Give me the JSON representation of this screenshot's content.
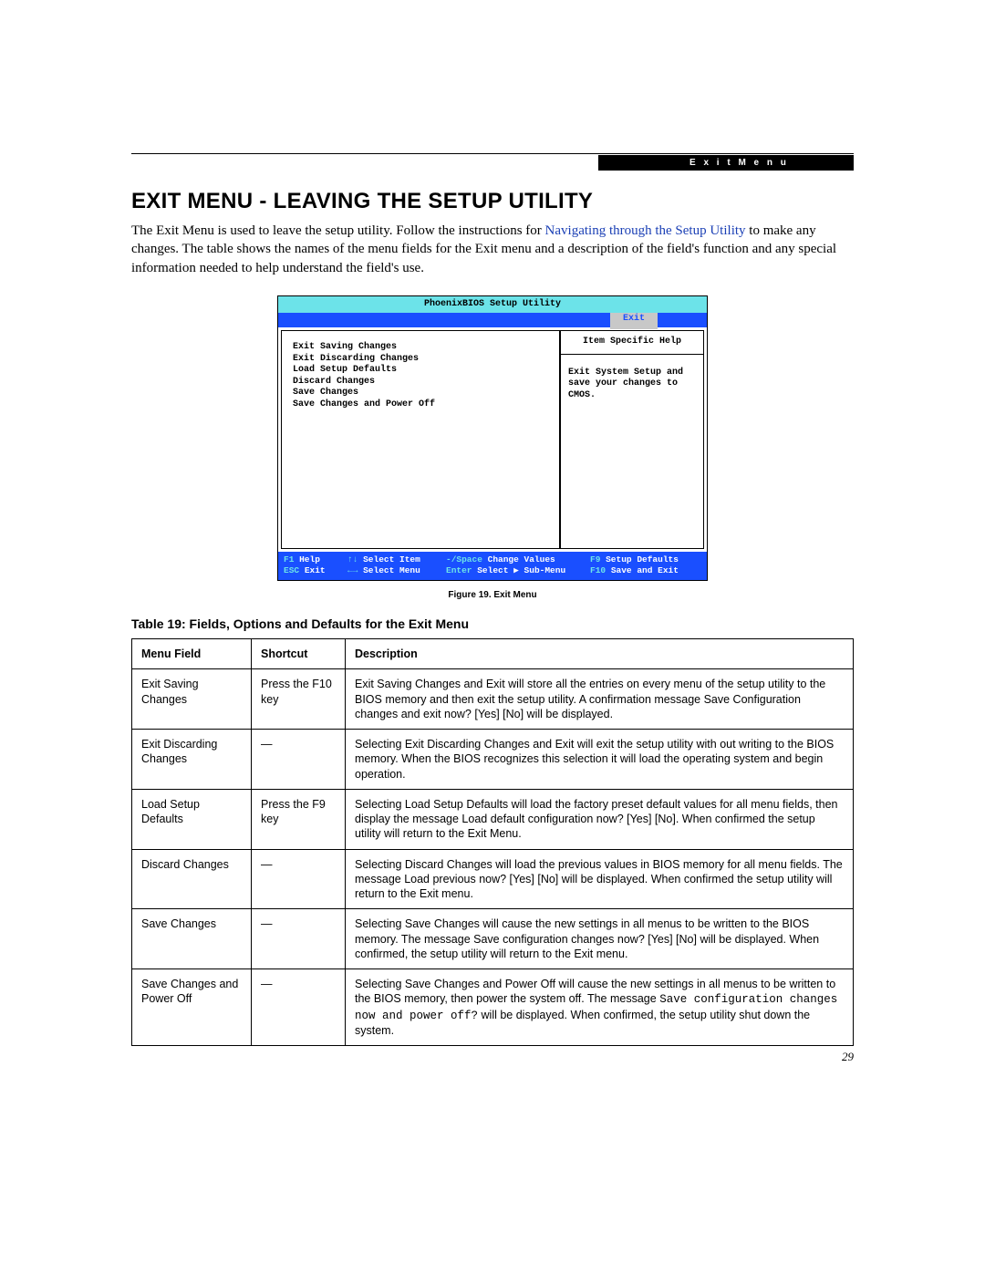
{
  "header": {
    "running_head": "E x i t   M e n u",
    "title": "EXIT MENU - LEAVING THE SETUP UTILITY",
    "intro_pre": "The Exit Menu is used to leave the setup utility. Follow the instructions for ",
    "intro_link": "Navigating through the Setup Utility",
    "intro_post": " to make any changes. The table shows the names of the menu fields for the Exit menu and a description of the field's function and any special information needed to help understand the field's use."
  },
  "bios": {
    "title": "PhoenixBIOS Setup Utility",
    "active_tab": "Exit",
    "menu_items": [
      "Exit Saving Changes",
      "Exit Discarding Changes",
      "Load Setup Defaults",
      "Discard Changes",
      "Save Changes",
      "Save Changes and Power Off"
    ],
    "help_title": "Item Specific Help",
    "help_body": "Exit System Setup and save your changes to CMOS.",
    "footer": {
      "r1": {
        "k1": "F1",
        "l1": "Help",
        "k2": "↑↓",
        "l2": "Select Item",
        "k3": "-/Space",
        "l3": "Change Values",
        "k4": "F9",
        "l4": "Setup Defaults"
      },
      "r2": {
        "k1": "ESC",
        "l1": "Exit",
        "k2": "←→",
        "l2": "Select Menu",
        "k3": "Enter",
        "l3": "Select ▶ Sub-Menu",
        "k4": "F10",
        "l4": "Save and Exit"
      }
    }
  },
  "figure_caption": "Figure 19.  Exit Menu",
  "table_title": "Table 19: Fields, Options and Defaults for the Exit Menu",
  "table": {
    "headers": {
      "field": "Menu Field",
      "shortcut": "Shortcut",
      "desc": "Description"
    },
    "rows": [
      {
        "field": "Exit Saving Changes",
        "shortcut": "Press the F10 key",
        "desc": "Exit Saving Changes and Exit will store all the entries on every menu of the setup utility to the BIOS memory and then exit the setup utility. A confirmation message Save Configuration changes and exit now? [Yes] [No] will be displayed."
      },
      {
        "field": "Exit Discarding Changes",
        "shortcut": "—",
        "desc": "Selecting Exit Discarding Changes and Exit will exit the setup utility with out writing to the BIOS memory. When the BIOS recognizes this selection it will load the operating system and begin operation."
      },
      {
        "field": "Load Setup Defaults",
        "shortcut": "Press the F9 key",
        "desc": "Selecting Load Setup Defaults will load the factory preset default values for all menu fields, then display the message Load default configuration now? [Yes] [No]. When confirmed the setup utility will return to the Exit Menu."
      },
      {
        "field": "Discard Changes",
        "shortcut": "—",
        "desc": "Selecting Discard Changes will load the previous values in BIOS memory for all menu fields. The message Load previous now? [Yes] [No] will be displayed. When confirmed the setup utility will return to the Exit menu."
      },
      {
        "field": "Save Changes",
        "shortcut": "—",
        "desc": "Selecting Save Changes will cause the new settings in all menus to be written to the BIOS memory. The message Save configuration changes now? [Yes] [No] will be displayed. When confirmed, the setup utility will return to the Exit menu."
      },
      {
        "field": "Save Changes and Power Off",
        "shortcut": "—",
        "desc_pre": "Selecting Save Changes and Power Off will cause the new settings in all menus to be written to the BIOS memory, then power the system off. The message ",
        "desc_mono": "Save configuration changes now and power off?",
        "desc_post": " will be displayed. When confirmed, the setup utility shut down the system."
      }
    ]
  },
  "page_number": "29"
}
